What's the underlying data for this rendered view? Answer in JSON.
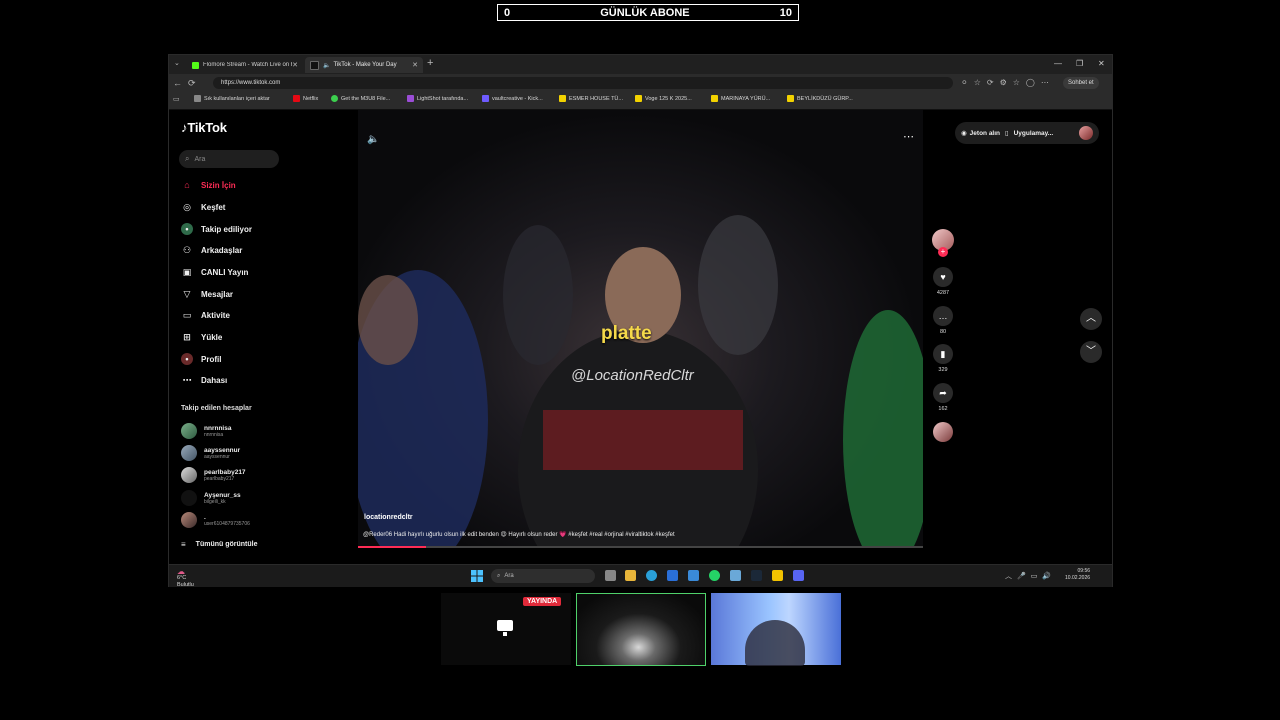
{
  "counter": {
    "left": "0",
    "title": "GÜNLÜK ABONE",
    "right": "10"
  },
  "browser": {
    "tabs": [
      {
        "label": "Flomore Stream - Watch Live on F",
        "color": "#53fc18"
      },
      {
        "label": "TikTok - Make Your Day",
        "color": "#ffffff"
      }
    ],
    "url": "https://www.tiktok.com",
    "copilot_label": "Sohbet et",
    "bookmarks": [
      {
        "label": "Sık kullanılanları içeri aktar",
        "color": "#888888"
      },
      {
        "label": "Netflix",
        "color": "#e50914"
      },
      {
        "label": "Get the M3U8 File...",
        "color": "#3ccf4e"
      },
      {
        "label": "LightShot tarafında...",
        "color": "#9b4dd6"
      },
      {
        "label": "vaultcreative - Kick...",
        "color": "#6e5bff"
      },
      {
        "label": "ESMER HOUSE TÜ...",
        "color": "#f2d200"
      },
      {
        "label": "Voge 125 K 2025...",
        "color": "#f2d200"
      },
      {
        "label": "MARINAYA YÜRÜ...",
        "color": "#f2d200"
      },
      {
        "label": "BEYLİKDÜZÜ GÜRP...",
        "color": "#f2d200"
      }
    ]
  },
  "tiktok": {
    "logo": "TikTok",
    "search_placeholder": "Ara",
    "nav": [
      {
        "label": "Sizin İçin",
        "icon": "home-icon"
      },
      {
        "label": "Keşfet",
        "icon": "compass-icon"
      },
      {
        "label": "Takip ediliyor",
        "icon": "following-icon"
      },
      {
        "label": "Arkadaşlar",
        "icon": "friends-icon"
      },
      {
        "label": "CANLI Yayın",
        "icon": "live-icon"
      },
      {
        "label": "Mesajlar",
        "icon": "messages-icon"
      },
      {
        "label": "Aktivite",
        "icon": "activity-icon"
      },
      {
        "label": "Yükle",
        "icon": "upload-icon"
      },
      {
        "label": "Profil",
        "icon": "profile-icon"
      },
      {
        "label": "Dahası",
        "icon": "more-icon"
      }
    ],
    "following_title": "Takip edilen hesaplar",
    "following": [
      {
        "name": "nnrnnisa",
        "handle": "nnrnnisa"
      },
      {
        "name": "aayssennur",
        "handle": "aayssennur"
      },
      {
        "name": "pearlbaby217",
        "handle": "pearlbaby217"
      },
      {
        "name": "Ayşenur_ss",
        "handle": "bilgeili_kk"
      },
      {
        "name": ".",
        "handle": "user6104879735706"
      }
    ],
    "see_all": "Tümünü görüntüle",
    "video": {
      "overlay_brand": "platte",
      "overlay_tag": "@LocationRedCltr",
      "author": "locationredcltr",
      "caption": "@Reder06 Hadi hayırlı uğurlu olsun ilk edit benden 😍 Hayırlı olsun reder 💗 #keşfet #real #orjinal #viraltiktok #keşfet",
      "progress_percent": 12
    },
    "actions": {
      "likes": "4287",
      "comments": "80",
      "saves": "329",
      "shares": "162"
    },
    "top_right": {
      "coins": "Jeton alın",
      "app": "Uygulamay..."
    }
  },
  "taskbar": {
    "weather_temp": "6°C",
    "weather_desc": "Bulutlu",
    "search_placeholder": "Ara",
    "time": "09:56",
    "date": "10.02.2026"
  },
  "cams": {
    "live_badge": "YAYINDA"
  }
}
